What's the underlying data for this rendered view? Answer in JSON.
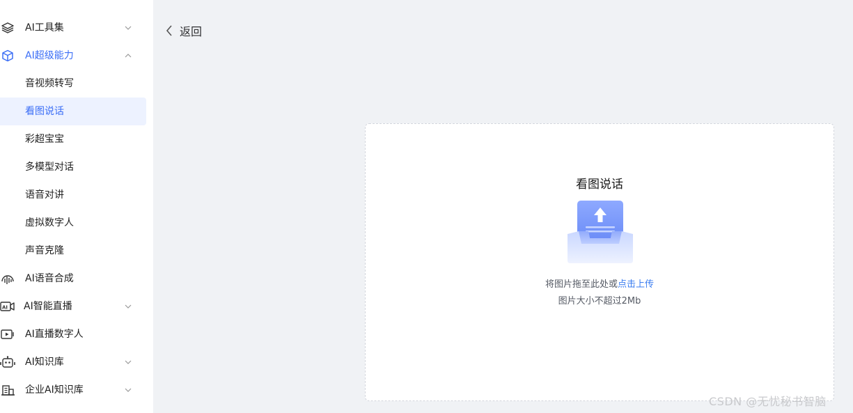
{
  "sidebar": {
    "items": [
      {
        "label": "AI工具集",
        "icon": "layers-icon"
      },
      {
        "label": "AI超级能力",
        "icon": "cube-icon",
        "expanded": true
      },
      {
        "label": "音视频转写"
      },
      {
        "label": "看图说话",
        "selected": true
      },
      {
        "label": "彩超宝宝"
      },
      {
        "label": "多模型对话"
      },
      {
        "label": "语音对讲"
      },
      {
        "label": "虚拟数字人"
      },
      {
        "label": "声音克隆"
      },
      {
        "label": "AI语音合成",
        "icon": "voice-wave-icon"
      },
      {
        "label": "AI智能直播",
        "icon": "ai-camera-icon"
      },
      {
        "label": "AI直播数字人",
        "icon": "video-play-icon"
      },
      {
        "label": "AI知识库",
        "icon": "robot-icon"
      },
      {
        "label": "企业AI知识库",
        "icon": "building-icon"
      }
    ]
  },
  "header": {
    "back_label": "返回"
  },
  "upload": {
    "title": "看图说话",
    "hint_prefix": "将图片拖至此处或",
    "hint_link": "点击上传",
    "limit": "图片大小不超过2Mb"
  },
  "watermark": "CSDN @无忧秘书智脑",
  "colors": {
    "accent": "#3b6ef6",
    "selected_bg": "#edf2ff",
    "page_bg": "#f0f2f5",
    "link": "#3b7df0"
  }
}
